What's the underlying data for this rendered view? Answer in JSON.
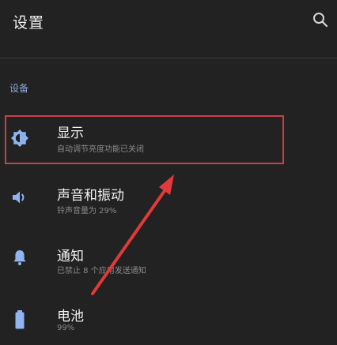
{
  "app_bar": {
    "title": "设置",
    "search_icon": "search-icon"
  },
  "section": {
    "header": "设备"
  },
  "items": [
    {
      "title": "显示",
      "subtitle": "自动调节亮度功能已关闭",
      "icon": "brightness-icon"
    },
    {
      "title": "声音和振动",
      "subtitle": "铃声音量为 29%",
      "icon": "volume-icon"
    },
    {
      "title": "通知",
      "subtitle": "已禁止 8 个应用发送通知",
      "icon": "bell-icon"
    },
    {
      "title": "电池",
      "subtitle": "99%",
      "icon": "battery-icon"
    }
  ],
  "colors": {
    "background": "#222222",
    "icon_accent": "#8fb4f0",
    "section_header": "#8ba6d6",
    "annotation_red": "#e03a3a"
  }
}
